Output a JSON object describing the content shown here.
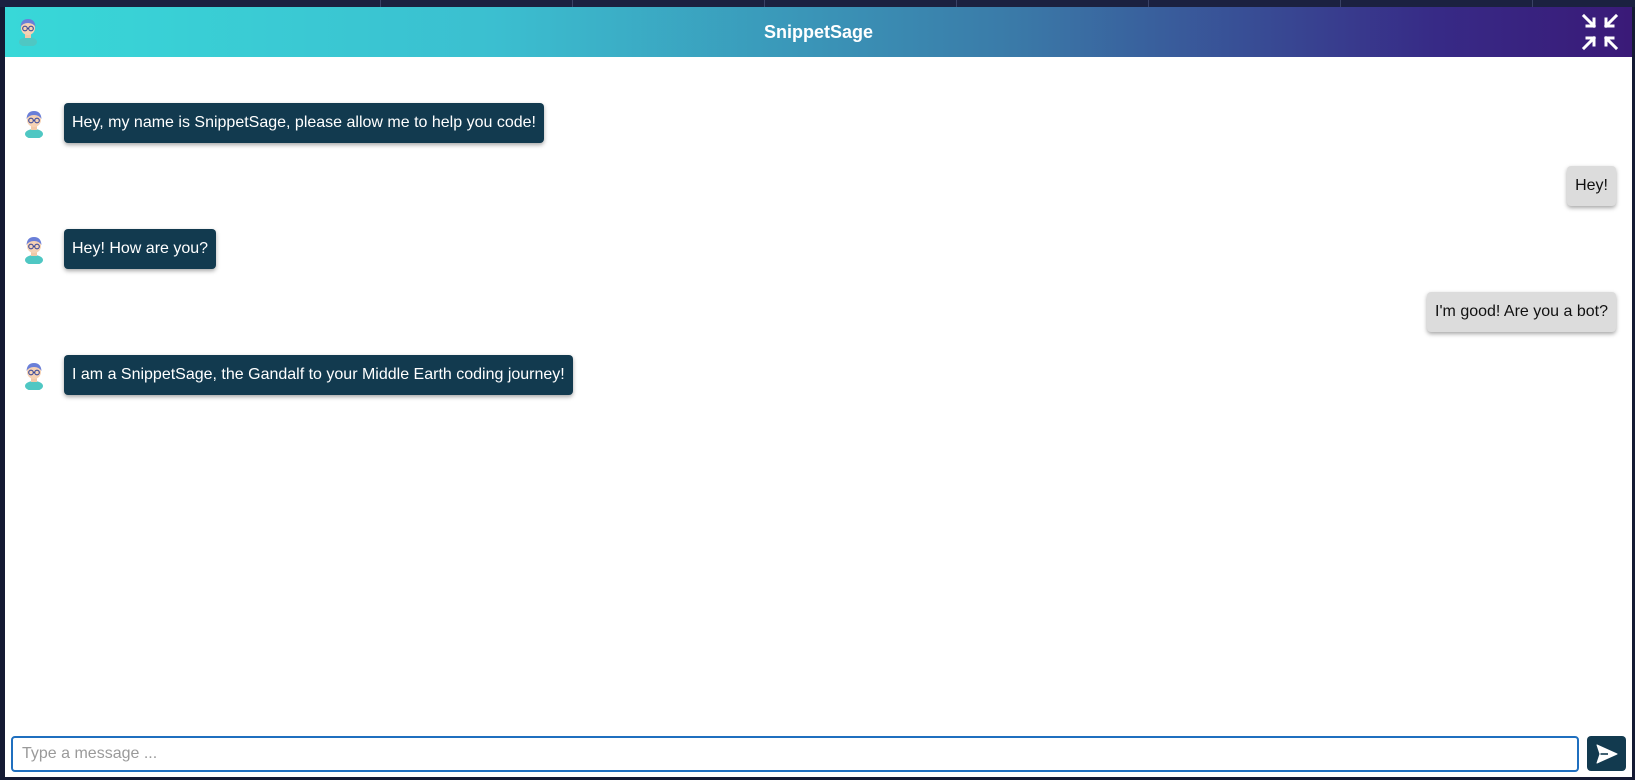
{
  "app": {
    "title": "SnippetSage"
  },
  "header": {
    "title": "SnippetSage",
    "avatar_icon": "sage-avatar-icon",
    "minimize_icon": "minimize-arrows-icon"
  },
  "messages": [
    {
      "sender": "bot",
      "text": "Hey, my name is SnippetSage, please allow me to help you code!"
    },
    {
      "sender": "user",
      "text": "Hey!"
    },
    {
      "sender": "bot",
      "text": "Hey! How are you?"
    },
    {
      "sender": "user",
      "text": "I'm good! Are you a bot?"
    },
    {
      "sender": "bot",
      "text": "I am a SnippetSage, the Gandalf to your Middle Earth coding journey!"
    }
  ],
  "composer": {
    "value": "",
    "placeholder": "Type a message ...",
    "send_icon": "send-icon"
  },
  "colors": {
    "header_gradient_start": "#38d8d8",
    "header_gradient_end": "#3a1a78",
    "bot_bubble": "#123a4f",
    "user_bubble": "#dcdcdc",
    "input_border": "#1f6fbf"
  }
}
